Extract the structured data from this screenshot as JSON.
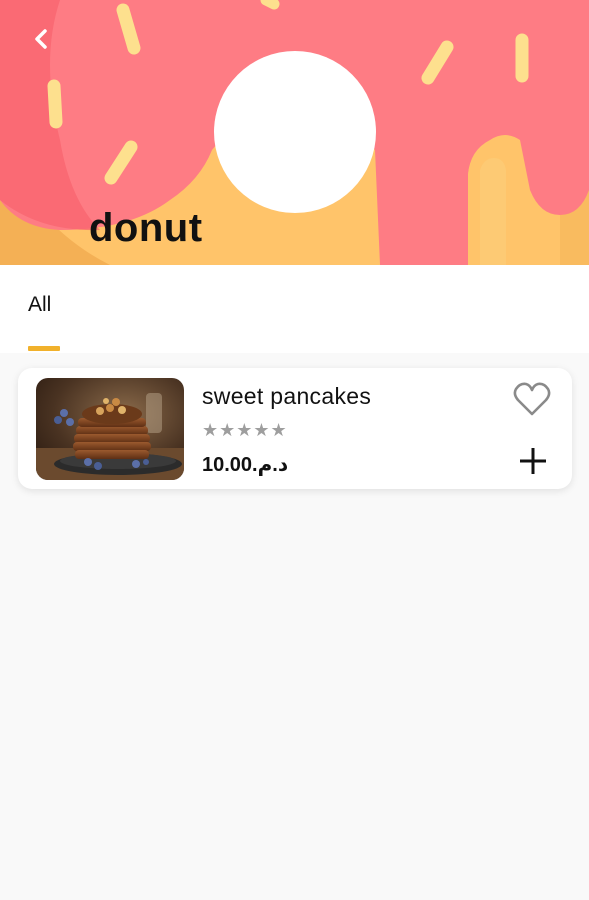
{
  "header": {
    "title": "donut",
    "back_icon": "chevron-left-icon",
    "banner_colors": {
      "frosting": "#fe7c84",
      "dough": "#ffc46a",
      "sprinkles": "#fde08e"
    }
  },
  "tabs": [
    {
      "label": "All",
      "active": true
    }
  ],
  "accent_color": "#f1b12b",
  "products": [
    {
      "name": "sweet pancakes",
      "rating_stars": "★★★★★",
      "rating": 0,
      "price": "10.00.د.م",
      "image_icon": "pancakes-photo",
      "favorite_icon": "heart-outline-icon",
      "add_icon": "plus-icon"
    }
  ]
}
